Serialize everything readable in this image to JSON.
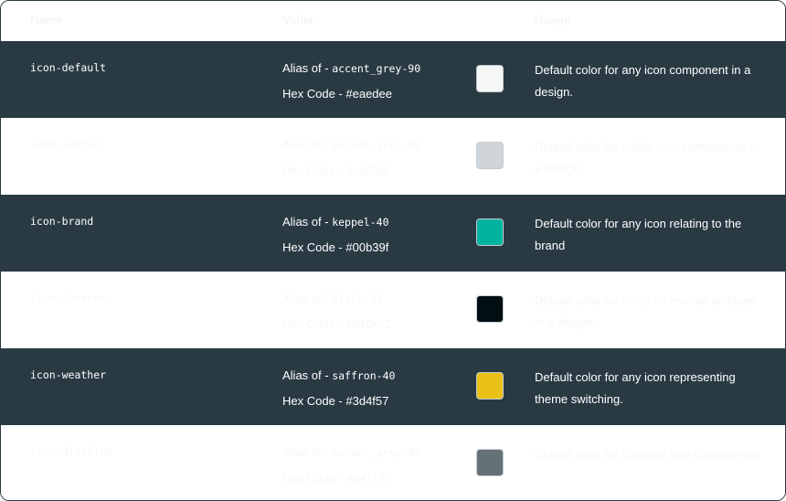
{
  "header": {
    "name": "Name",
    "value": "Value",
    "usage": "Usage"
  },
  "rows": [
    {
      "theme": "dark",
      "token": "icon-default",
      "alias_prefix": "Alias of - ",
      "alias": "accent_grey-90",
      "hex_prefix": "Hex Code - ",
      "hex": "#eaedee",
      "swatch_color": "#f5f7f7",
      "description": "Default color for any icon component in a design."
    },
    {
      "theme": "light",
      "token": "icon-subtle",
      "alias_prefix": "Alias of - ",
      "alias": "accent_grey-70",
      "hex_prefix": "Hex Code - ",
      "hex": "#cfd5d8",
      "swatch_color": "#cfd5d8",
      "description": "Default color for subtle icon components in a design."
    },
    {
      "theme": "dark",
      "token": "icon-brand",
      "alias_prefix": "Alias of - ",
      "alias": "keppel-40",
      "hex_prefix": "Hex Code - ",
      "hex": "#00b39f",
      "swatch_color": "#00b39f",
      "description": "Default color for any icon relating to the brand"
    },
    {
      "theme": "light",
      "token": "icon-inverse",
      "alias_prefix": "Alias of - ",
      "alias": "black-10",
      "hex_prefix": "Hex Code - ",
      "hex": "#010e12",
      "swatch_color": "#010e12",
      "description": "Default color for icons on inverse surfaces in a design."
    },
    {
      "theme": "dark",
      "token": "icon-weather",
      "alias_prefix": "Alias of - ",
      "alias": "saffron-40",
      "hex_prefix": "Hex Code - ",
      "hex": "#3d4f57",
      "swatch_color": "#ebc017",
      "description": "Default color for any icon representing theme switching."
    },
    {
      "theme": "light",
      "token": "icon-disabled",
      "alias_prefix": "Alias of - ",
      "alias": "accent_grey-40",
      "hex_prefix": "Hex Code - ",
      "hex": "#647176",
      "swatch_color": "#647176",
      "description": "Default color for disabled icon components."
    }
  ]
}
